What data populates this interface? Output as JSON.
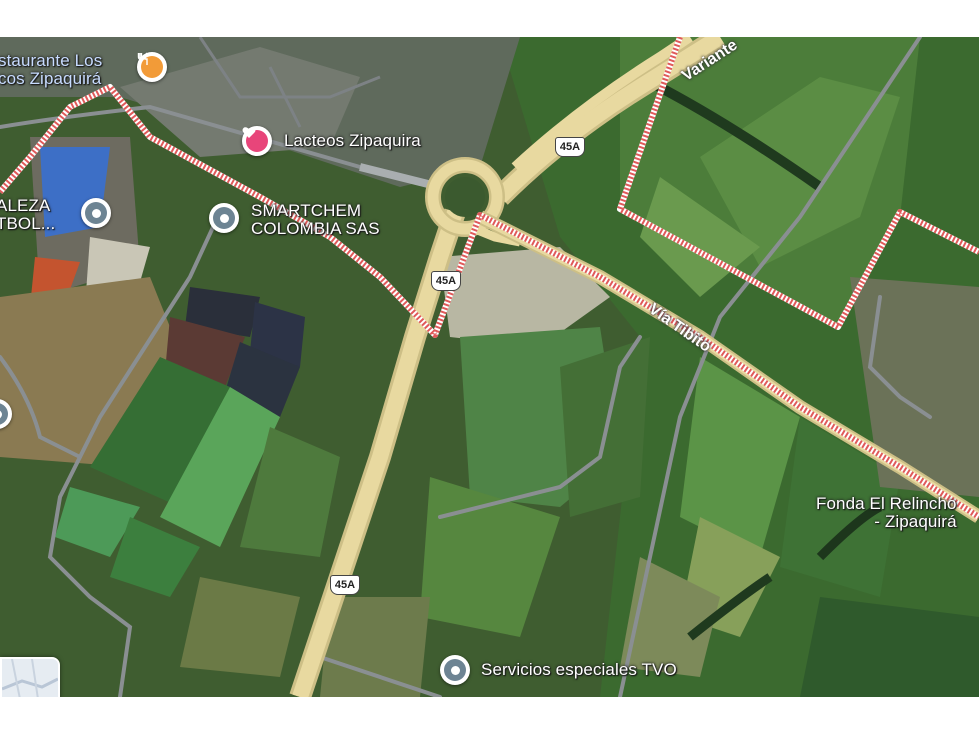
{
  "map": {
    "view": "satellite",
    "places": [
      {
        "name_line1": "staurante Los",
        "name_line2": "cos Zipaquirá",
        "icon": "restaurant-icon",
        "color": "#f29b38"
      },
      {
        "name": "Lacteos Zipaquira",
        "icon": "heart-icon",
        "color": "#e8457a"
      },
      {
        "name_line1": "ALEZA",
        "name_line2": "TBOL...",
        "icon": "place-pin-icon",
        "color": "#6d8493"
      },
      {
        "name_line1": "SMARTCHEM",
        "name_line2": "COLOMBIA SAS",
        "icon": "place-pin-icon",
        "color": "#6d8493"
      },
      {
        "name_line1": "Fonda El Relincho",
        "name_line2": "- Zipaquirá",
        "icon": "none"
      },
      {
        "name": "Servicios especiales TVO",
        "icon": "place-pin-icon",
        "color": "#6d8493"
      }
    ],
    "roads": [
      {
        "name": "Variante",
        "type": "highway"
      },
      {
        "name": "Vía Tibito",
        "type": "arterial"
      }
    ],
    "route_shields": [
      "45A",
      "45A",
      "45A"
    ],
    "colors": {
      "highway": "#e8d9a0",
      "boundary": "#e05a5a",
      "field_green": "#4f8a45",
      "dark_field": "#2f3d45"
    }
  }
}
